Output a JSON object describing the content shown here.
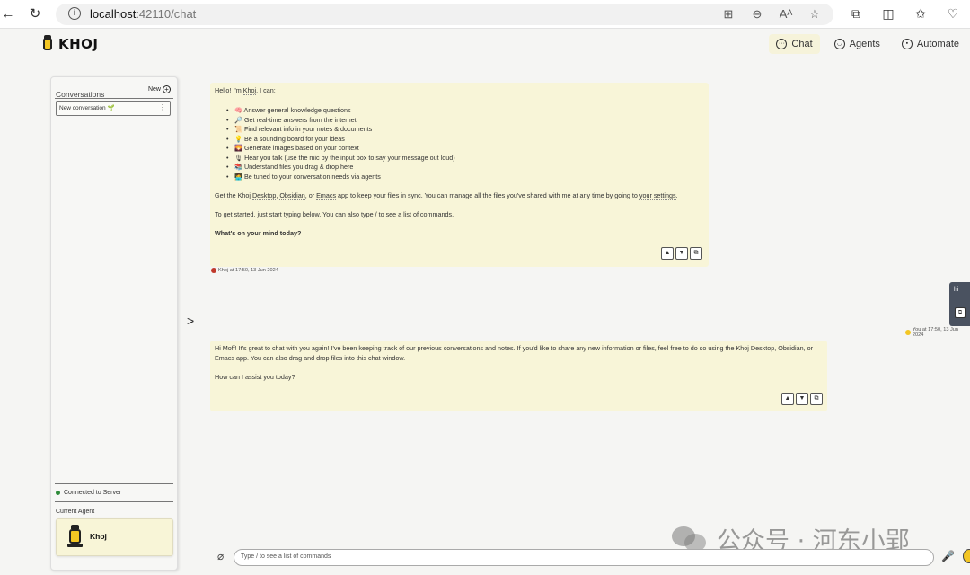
{
  "browser": {
    "url_host": "localhost",
    "url_path": ":42110/chat"
  },
  "app": {
    "logo_text": "KHOJ",
    "nav": [
      {
        "label": "Chat"
      },
      {
        "label": "Agents"
      },
      {
        "label": "Automate"
      }
    ]
  },
  "sidebar": {
    "title": "Conversations",
    "new_label": "New",
    "conversation_item": "New conversation 🌱",
    "status": "Connected to Server",
    "current_agent_label": "Current Agent",
    "agent_name": "Khoj"
  },
  "messages": {
    "greeting": {
      "intro_pre": "Hello! I'm ",
      "intro_link": "Khoj",
      "intro_post": ". I can:",
      "bullets": [
        "🧠 Answer general knowledge questions",
        "🔎 Get real-time answers from the internet",
        "📜 Find relevant info in your notes & documents",
        "💡 Be a sounding board for your ideas",
        "🌄 Generate images based on your context",
        "🎙 Hear you talk (use the mic by the input box to say your message out loud)",
        "📚 Understand files you drag & drop here"
      ],
      "bullet_last_pre": "🧑‍💻 Be tuned to your conversation needs via ",
      "bullet_last_link": "agents",
      "sync_1": "Get the Khoj ",
      "sync_desktop": "Desktop",
      "sync_2": ", ",
      "sync_obsidian": "Obsidian",
      "sync_3": ", or ",
      "sync_emacs": "Emacs",
      "sync_4": " app to keep your files in sync. You can manage all the files you've shared with me at any time by going to ",
      "sync_settings": "your settings",
      "sync_5": ".",
      "start": "To get started, just start typing below. You can also type / to see a list of commands.",
      "question": "What's on your mind today?",
      "meta": "Khoj at 17:50, 13 Jun 2024"
    },
    "user": {
      "text": "hi",
      "meta": "You at 17:50, 13 Jun 2024"
    },
    "reply": {
      "para1": "Hi Moff! It's great to chat with you again! I've been keeping track of our previous conversations and notes. If you'd like to share any new information or files, feel free to do so using the Khoj Desktop, Obsidian, or Emacs app. You can also drag and drop files into this chat window.",
      "para2": "How can I assist you today?"
    }
  },
  "composer": {
    "placeholder": "Type / to see a list of commands"
  },
  "watermark": {
    "text": "公众号 · 河东小郢"
  },
  "icons": {
    "back": "arrow-left-icon",
    "reload": "reload-icon",
    "info": "info-icon",
    "chat": "chat-bubble-icon",
    "agents": "agent-face-icon",
    "automate": "robot-icon",
    "thumbs_up": "thumbs-up-icon",
    "thumbs_down": "thumbs-down-icon",
    "copy": "copy-icon",
    "attach": "paperclip-icon",
    "mic": "microphone-icon"
  },
  "colors": {
    "message_bg": "#f8f5d8",
    "accent": "#f3c623",
    "status_green": "#2e8b3a",
    "user_bubble": "#4a5260"
  }
}
